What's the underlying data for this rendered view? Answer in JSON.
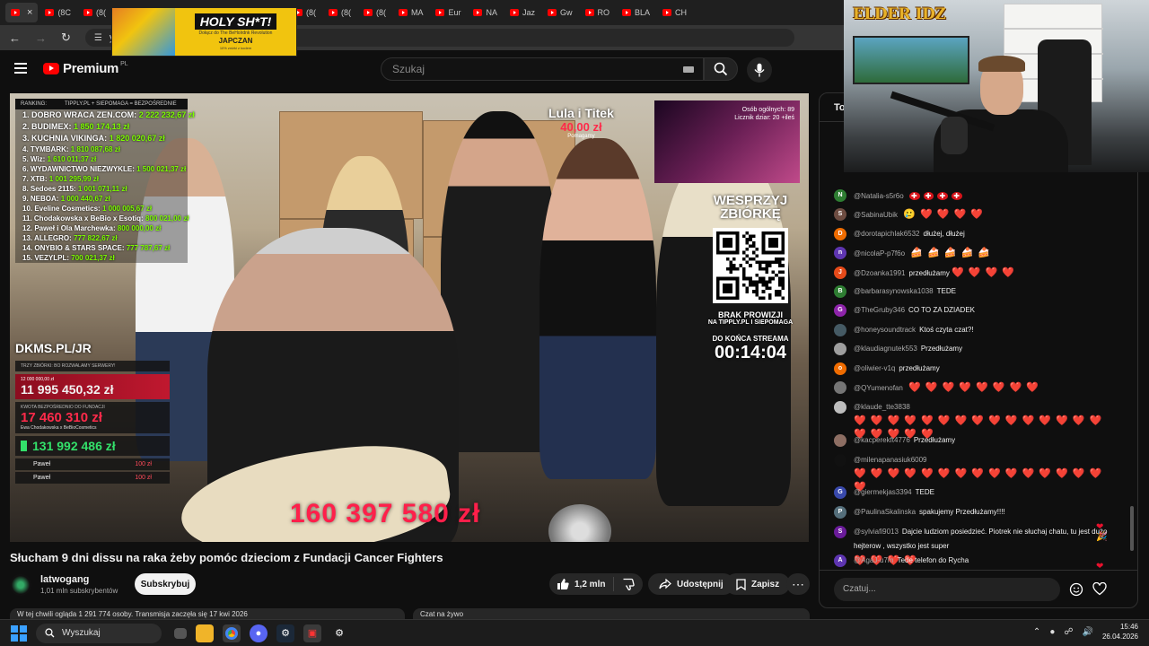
{
  "browser": {
    "tabs": [
      {
        "label": "",
        "active": true
      },
      {
        "label": "(8C"
      },
      {
        "label": "(8("
      },
      {
        "label": "(8("
      },
      {
        "label": "(8("
      },
      {
        "label": "(8("
      },
      {
        "label": "(8("
      },
      {
        "label": "(8("
      },
      {
        "label": "(8("
      },
      {
        "label": "(8("
      },
      {
        "label": "(8("
      },
      {
        "label": "MA"
      },
      {
        "label": "Eur"
      },
      {
        "label": "NA"
      },
      {
        "label": "Jaz"
      },
      {
        "label": "Gw"
      },
      {
        "label": "RO"
      },
      {
        "label": "BLA"
      },
      {
        "label": "CH"
      }
    ],
    "url": "yout",
    "accent": "#ff0000"
  },
  "ad": {
    "title": "HOLY SH*T!",
    "subtitle": "Dołącz do The BeHolrdnk Revolution",
    "brand": "JAPCZAN",
    "small": "10% zniżki z kodem"
  },
  "youtube": {
    "logo": "Premium",
    "country": "PL",
    "search_placeholder": "Szukaj"
  },
  "video": {
    "ranking_header": [
      "RANKING:",
      "TIPPLY.PL + SIEPOMAGA = BEZPOŚREDNIE"
    ],
    "ranking": [
      {
        "text": "1. DOBRO WRACA ZEN.COM:",
        "amount": "2 222 232,67 zł"
      },
      {
        "text": "2. BUDIMEX:",
        "amount": "1 850 174,13 zł"
      },
      {
        "text": "3. KUCHNIA VIKINGA:",
        "amount": "1 820 020,67 zł"
      },
      {
        "text": "4. TYMBARK:",
        "amount": "1 810 087,68 zł"
      },
      {
        "text": "5. Wiz:",
        "amount": "1 610 011,37 zł"
      },
      {
        "text": "6. WYDAWNICTWO NIEZWYKLE:",
        "amount": "1 500 021,37 zł"
      },
      {
        "text": "7. XTB:",
        "amount": "1 001 295,99 zł"
      },
      {
        "text": "8. Sedoes 2115:",
        "amount": "1 001 071,11 zł"
      },
      {
        "text": "9. NEBOA:",
        "amount": "1 000 440,67 zł"
      },
      {
        "text": "10. Eveline Cosmetics:",
        "amount": "1 000 005,67 zł"
      },
      {
        "text": "11. Chodakowska x BeBio x Esotiq:",
        "amount": "800 021,00 zł"
      },
      {
        "text": "12. Paweł i Ola Marchewka:",
        "amount": "800 000,00 zł"
      },
      {
        "text": "13. ALLEGRO:",
        "amount": "777 822,67 zł"
      },
      {
        "text": "14. ONYBIO & STARS SPACE:",
        "amount": "777 787,67 zł"
      },
      {
        "text": "15. VEZYLPL:",
        "amount": "700 021,37 zł"
      }
    ],
    "dkms": "DKMS.PL/JR",
    "goal_caption": "TRZY ZBIÓRKI: BO ROZWALAMY SERWERY!",
    "goal_target": "12 000 000,00 zł",
    "goal1": "11 995 450,32 zł",
    "goal2_caption": "KWOTA BEZPOŚREDNIO DO FUNDACJI",
    "goal2": "17 460 310 zł",
    "goal2_sub": "Ewa Chodakowska x BeBioCosmetics",
    "goal3": "131 992 486 zł",
    "donors": [
      {
        "name": "Paweł",
        "value": "100 zł"
      },
      {
        "name": "Paweł",
        "value": "100 zł"
      }
    ],
    "lula_name": "Lula i Titek",
    "lula_amount": "40,00 zł",
    "lula_sub": "Pomagamy",
    "cam_stats": [
      "Osób ogólnych: 89",
      "Licznik dziar: 20 +ileś"
    ],
    "wesprzyj": "WESPRZYJ ZBIÓRKĘ",
    "brak": "BRAK PROWIZJI",
    "brak2": "NA TIPPLY.PL I SIEPOMAGA",
    "do_konca": "DO KOŃCA STREAMA",
    "timer": "00:14:04",
    "total": "160 397 580 zł"
  },
  "below": {
    "title": "Słucham 9 dni dissu na raka żeby pomóc dzieciom z Fundacji Cancer Fighters",
    "channel": "latwogang",
    "subs": "1,01 mln subskrybentów",
    "subscribe": "Subskrybuj",
    "likes": "1,2 mln",
    "share": "Udostępnij",
    "save": "Zapisz",
    "views": "W tej chwili ogląda 1 291 774 osoby. Transmisja zaczęła się 17 kwi 2026",
    "live_chat": "Czat na żywo"
  },
  "chat": {
    "header": "To",
    "input_placeholder": "Czatuj...",
    "messages": [
      {
        "author": "@Natalia-s5r6o",
        "text": "",
        "initial": "N",
        "color": "#2e7d32",
        "kind": "flags",
        "count": 4
      },
      {
        "author": "@SabinaUbik",
        "text": "",
        "initial": "S",
        "color": "#6d4c41",
        "kind": "emoji-hearts",
        "count": 4
      },
      {
        "author": "@dorotapichlak6532",
        "text": "dłużej, dłużej",
        "initial": "D",
        "color": "#ef6c00"
      },
      {
        "author": "@nicolaP-p7f6o",
        "text": "",
        "initial": "n",
        "color": "#5e35b1",
        "kind": "cakes",
        "count": 5
      },
      {
        "author": "@Dzoanka1991",
        "text": "przedłużamy",
        "initial": "J",
        "color": "#e64a19",
        "kind": "hearts",
        "count": 4
      },
      {
        "author": "@barbarasynowska1038",
        "text": "TEDE",
        "initial": "B",
        "color": "#2e7d32"
      },
      {
        "author": "@TheGruby346",
        "text": "CO TO ZA DZIADEK",
        "initial": "G",
        "color": "#8e24aa"
      },
      {
        "author": "@honeysoundtrack",
        "text": "Ktoś czyta czat?!",
        "initial": "",
        "color": "#455a64"
      },
      {
        "author": "@klaudiagnutek553",
        "text": "Przedłużamy",
        "initial": "",
        "color": "#9e9e9e"
      },
      {
        "author": "@oliwier-v1q",
        "text": "przedłużamy",
        "initial": "o",
        "color": "#ef6c00"
      },
      {
        "author": "@QYumenofan",
        "text": "",
        "initial": "",
        "color": "#757575",
        "kind": "hearts",
        "count": 8
      },
      {
        "author": "@klaude_tte3838",
        "text": "",
        "initial": "",
        "color": "#bdbdbd",
        "kind": "hearts",
        "count": 20
      },
      {
        "author": "@kacperekft4776",
        "text": "Przedłużamy",
        "initial": "",
        "color": "#8d6e63"
      },
      {
        "author": "@milenapanasiuk6009",
        "text": "",
        "initial": "",
        "color": "#111111",
        "kind": "hearts",
        "count": 16
      },
      {
        "author": "@giermekjas3394",
        "text": "TEDE",
        "initial": "G",
        "color": "#3949ab"
      },
      {
        "author": "@PaulinaSkalinska",
        "text": "spakujemy Przedłużamy!!!!",
        "initial": "P",
        "color": "#546e7a"
      },
      {
        "author": "@sylviafi9013",
        "text": "Dajcie ludziom posiedzieć. Piotrek nie słuchaj chatu, tu jest dużo hejterow , wszystko jest super",
        "initial": "S",
        "color": "#6a1b9a",
        "kind": "hearts-first",
        "count": 4
      },
      {
        "author": "@AgaJ-u7m",
        "text": "Tede telefon do Rycha",
        "initial": "A",
        "color": "#5e35b1"
      }
    ]
  },
  "streamer": {
    "sign": "ELDER IDZ"
  },
  "taskbar": {
    "search": "Wyszukaj",
    "time": "15:46",
    "date": "26.04.2026"
  }
}
